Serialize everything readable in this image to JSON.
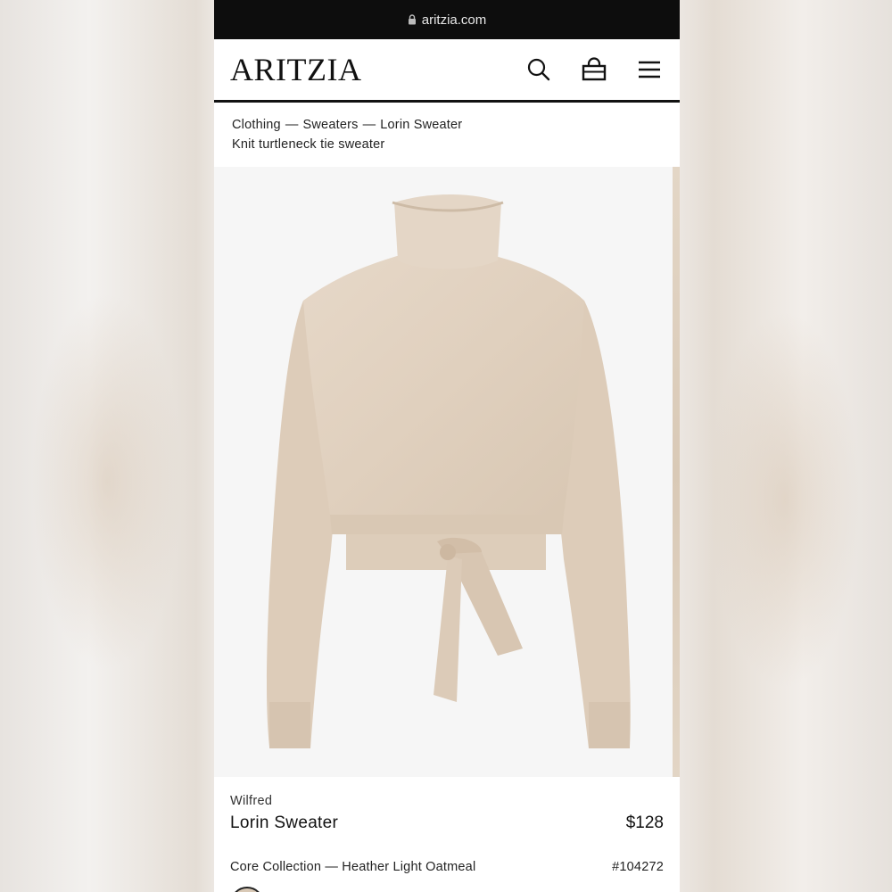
{
  "browser": {
    "url": "aritzia.com"
  },
  "header": {
    "logo": "ARITZIA",
    "icons": [
      "search-icon",
      "bag-icon",
      "menu-icon"
    ]
  },
  "breadcrumb": {
    "items": [
      "Clothing",
      "Sweaters",
      "Lorin Sweater"
    ],
    "separator": "—"
  },
  "product": {
    "subtitle": "Knit turtleneck tie sweater",
    "brand": "Wilfred",
    "name": "Lorin Sweater",
    "price": "$128",
    "collection_color": "Core Collection — Heather Light Oatmeal",
    "style_number": "#104272",
    "image_color": "#e2d3c2"
  },
  "colors": {
    "url_bar": "#0d0d0d",
    "header_rule": "#111111",
    "sweater": "#e2d3c2"
  }
}
